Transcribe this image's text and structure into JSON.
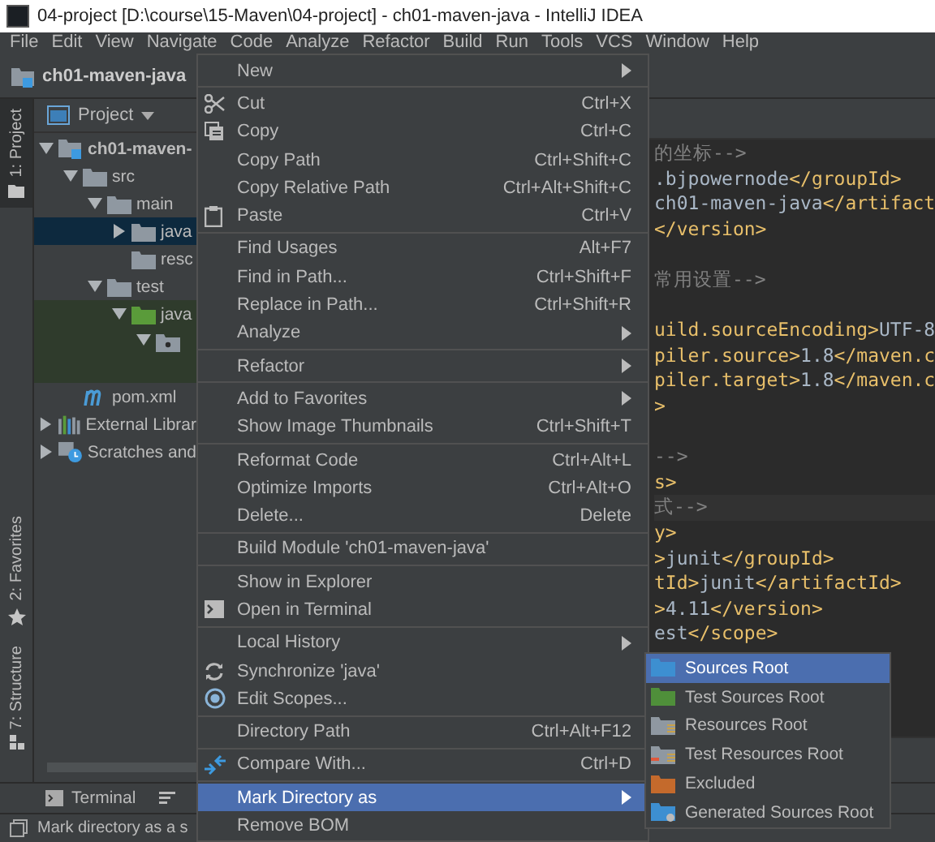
{
  "window": {
    "title": "04-project [D:\\course\\15-Maven\\04-project] - ch01-maven-java - IntelliJ IDEA"
  },
  "menu_bar": [
    "File",
    "Edit",
    "View",
    "Navigate",
    "Code",
    "Analyze",
    "Refactor",
    "Build",
    "Run",
    "Tools",
    "VCS",
    "Window",
    "Help"
  ],
  "breadcrumb": "ch01-maven-java",
  "side_tabs": [
    {
      "label": "1: Project",
      "selected": true
    },
    {
      "label": "2: Favorites",
      "selected": false
    },
    {
      "label": "7: Structure",
      "selected": false
    }
  ],
  "project_panel": {
    "title": "Project",
    "tree": [
      {
        "label": "ch01-maven-",
        "kind": "module",
        "expanded": true,
        "selected": false,
        "children": [
          {
            "label": "src",
            "kind": "folder",
            "expanded": true,
            "selected": false,
            "children": [
              {
                "label": "main",
                "kind": "folder",
                "expanded": true,
                "selected": false,
                "children": [
                  {
                    "label": "java",
                    "kind": "folder",
                    "expanded": false,
                    "selected": true
                  },
                  {
                    "label": "resc",
                    "kind": "folder",
                    "selected": false
                  }
                ]
              },
              {
                "label": "test",
                "kind": "folder",
                "expanded": true,
                "selected": false,
                "children": [
                  {
                    "label": "java",
                    "kind": "test-folder",
                    "expanded": true,
                    "selected": false,
                    "children": [
                      {
                        "kind": "package",
                        "expanded": true,
                        "selected": false
                      }
                    ]
                  }
                ]
              }
            ]
          },
          {
            "label": "pom.xml",
            "kind": "maven",
            "selected": false
          }
        ]
      },
      {
        "label": "External Librar",
        "kind": "library",
        "expanded": false,
        "selected": false
      },
      {
        "label": "Scratches and",
        "kind": "scratches",
        "expanded": false,
        "selected": false
      }
    ]
  },
  "editor_lines": [
    {
      "segments": [
        {
          "kind": "comment",
          "text": "的坐标-->"
        }
      ]
    },
    {
      "segments": [
        {
          "kind": "text",
          "text": ".bjpowernode"
        },
        {
          "kind": "tag",
          "text": "</groupId>"
        }
      ]
    },
    {
      "segments": [
        {
          "kind": "text",
          "text": "ch01-maven-java"
        },
        {
          "kind": "tag",
          "text": "</artifact"
        }
      ]
    },
    {
      "segments": [
        {
          "kind": "tag",
          "text": "</version>"
        }
      ]
    },
    {
      "kind": "blank"
    },
    {
      "segments": [
        {
          "kind": "comment",
          "text": "常用设置-->"
        }
      ]
    },
    {
      "kind": "blank"
    },
    {
      "segments": [
        {
          "kind": "tag",
          "text": "uild.sourceEncoding>"
        },
        {
          "kind": "text",
          "text": "UTF-8"
        }
      ]
    },
    {
      "segments": [
        {
          "kind": "tag",
          "text": "piler.source>"
        },
        {
          "kind": "text",
          "text": "1.8"
        },
        {
          "kind": "tag",
          "text": "</maven.c"
        }
      ]
    },
    {
      "segments": [
        {
          "kind": "tag",
          "text": "piler.target>"
        },
        {
          "kind": "text",
          "text": "1.8"
        },
        {
          "kind": "tag",
          "text": "</maven.c"
        }
      ]
    },
    {
      "segments": [
        {
          "kind": "tag",
          "text": ">"
        }
      ]
    },
    {
      "kind": "blank"
    },
    {
      "segments": [
        {
          "kind": "comment",
          "text": "-->"
        }
      ]
    },
    {
      "segments": [
        {
          "kind": "tag",
          "text": "s>"
        }
      ]
    },
    {
      "current": true,
      "segments": [
        {
          "kind": "comment",
          "text": "式-->"
        }
      ]
    },
    {
      "segments": [
        {
          "kind": "tag",
          "text": "y>"
        }
      ]
    },
    {
      "segments": [
        {
          "kind": "tag",
          "text": ">"
        },
        {
          "kind": "text",
          "text": "junit"
        },
        {
          "kind": "tag",
          "text": "</groupId>"
        }
      ]
    },
    {
      "segments": [
        {
          "kind": "tag",
          "text": "tId>"
        },
        {
          "kind": "text",
          "text": "junit"
        },
        {
          "kind": "tag",
          "text": "</artifactId>"
        }
      ]
    },
    {
      "segments": [
        {
          "kind": "tag",
          "text": ">"
        },
        {
          "kind": "text",
          "text": "4.11"
        },
        {
          "kind": "tag",
          "text": "</version>"
        }
      ]
    },
    {
      "segments": [
        {
          "kind": "text",
          "text": "est"
        },
        {
          "kind": "tag",
          "text": "</scope>"
        }
      ]
    }
  ],
  "context_menu": [
    {
      "kind": "item",
      "label": "New",
      "submenu": true,
      "selected": false
    },
    {
      "kind": "separator"
    },
    {
      "kind": "cut",
      "label": "Cut",
      "shortcut": "Ctrl+X",
      "selected": false
    },
    {
      "kind": "copy",
      "label": "Copy",
      "shortcut": "Ctrl+C",
      "selected": false
    },
    {
      "kind": "item",
      "label": "Copy Path",
      "shortcut": "Ctrl+Shift+C",
      "selected": false
    },
    {
      "kind": "item",
      "label": "Copy Relative Path",
      "shortcut": "Ctrl+Alt+Shift+C",
      "selected": false
    },
    {
      "kind": "paste",
      "label": "Paste",
      "shortcut": "Ctrl+V",
      "selected": false
    },
    {
      "kind": "separator"
    },
    {
      "kind": "item",
      "label": "Find Usages",
      "shortcut": "Alt+F7",
      "selected": false
    },
    {
      "kind": "item",
      "label": "Find in Path...",
      "shortcut": "Ctrl+Shift+F",
      "selected": false
    },
    {
      "kind": "item",
      "label": "Replace in Path...",
      "shortcut": "Ctrl+Shift+R",
      "selected": false
    },
    {
      "kind": "item",
      "label": "Analyze",
      "submenu": true,
      "selected": false
    },
    {
      "kind": "separator"
    },
    {
      "kind": "item",
      "label": "Refactor",
      "submenu": true,
      "selected": false
    },
    {
      "kind": "separator"
    },
    {
      "kind": "item",
      "label": "Add to Favorites",
      "submenu": true,
      "selected": false
    },
    {
      "kind": "item",
      "label": "Show Image Thumbnails",
      "shortcut": "Ctrl+Shift+T",
      "selected": false
    },
    {
      "kind": "separator"
    },
    {
      "kind": "item",
      "label": "Reformat Code",
      "shortcut": "Ctrl+Alt+L",
      "selected": false
    },
    {
      "kind": "item",
      "label": "Optimize Imports",
      "shortcut": "Ctrl+Alt+O",
      "selected": false
    },
    {
      "kind": "item",
      "label": "Delete...",
      "shortcut": "Delete",
      "selected": false
    },
    {
      "kind": "separator"
    },
    {
      "kind": "item",
      "label": "Build Module 'ch01-maven-java'",
      "selected": false
    },
    {
      "kind": "separator"
    },
    {
      "kind": "item",
      "label": "Show in Explorer",
      "selected": false
    },
    {
      "kind": "terminal",
      "label": "Open in Terminal",
      "selected": false
    },
    {
      "kind": "separator"
    },
    {
      "kind": "item",
      "label": "Local History",
      "submenu": true,
      "selected": false
    },
    {
      "kind": "sync",
      "label": "Synchronize 'java'",
      "selected": false
    },
    {
      "kind": "scope",
      "label": "Edit Scopes...",
      "selected": false
    },
    {
      "kind": "separator"
    },
    {
      "kind": "item",
      "label": "Directory Path",
      "shortcut": "Ctrl+Alt+F12",
      "selected": false
    },
    {
      "kind": "separator"
    },
    {
      "kind": "compare",
      "label": "Compare With...",
      "shortcut": "Ctrl+D",
      "selected": false
    },
    {
      "kind": "separator"
    },
    {
      "kind": "item",
      "label": "Mark Directory as",
      "submenu": true,
      "selected": true
    },
    {
      "kind": "item",
      "label": "Remove BOM",
      "selected": false
    }
  ],
  "submenu": [
    {
      "label": "Sources Root",
      "kind": "sources",
      "selected": true
    },
    {
      "label": "Test Sources Root",
      "kind": "test-sources",
      "selected": false
    },
    {
      "label": "Resources Root",
      "kind": "resources",
      "selected": false
    },
    {
      "label": "Test Resources Root",
      "kind": "test-resources",
      "selected": false
    },
    {
      "label": "Excluded",
      "kind": "excluded",
      "selected": false
    },
    {
      "label": "Generated Sources Root",
      "kind": "generated",
      "selected": false
    }
  ],
  "bottom_tabs": [
    "Terminal"
  ],
  "status_bar": "Mark directory as a s"
}
